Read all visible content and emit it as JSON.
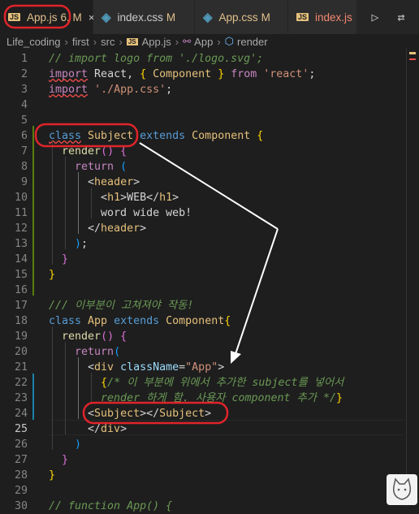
{
  "tabs": [
    {
      "label": "App.js",
      "badge": "6, M",
      "icon": "JS",
      "close": "×",
      "active": true
    },
    {
      "label": "index.css",
      "badge": "M",
      "icon": "css-icon"
    },
    {
      "label": "App.css",
      "badge": "M",
      "icon": "css-icon"
    },
    {
      "label": "index.js",
      "icon": "JS"
    }
  ],
  "tab_actions": {
    "run": "▷",
    "compare": "⇄"
  },
  "breadcrumb": {
    "items": [
      "Life_coding",
      "first",
      "src",
      "App.js",
      "App",
      "render"
    ],
    "sep": "›"
  },
  "editor": {
    "current_line": 25,
    "lines": [
      {
        "n": "1",
        "t": [
          [
            "c-cm",
            "// import logo from './logo.svg';"
          ]
        ]
      },
      {
        "n": "2",
        "t": [
          [
            "c-kw wavy",
            "import"
          ],
          [
            "c-txt",
            " React, "
          ],
          [
            "c-p1",
            "{"
          ],
          [
            "c-txt",
            " "
          ],
          [
            "c-cls",
            "Component"
          ],
          [
            "c-txt",
            " "
          ],
          [
            "c-p1",
            "}"
          ],
          [
            "c-txt",
            " "
          ],
          [
            "c-kw",
            "from"
          ],
          [
            "c-txt",
            " "
          ],
          [
            "c-str",
            "'react'"
          ],
          [
            "c-txt",
            ";"
          ]
        ]
      },
      {
        "n": "3",
        "t": [
          [
            "c-kw wavy",
            "import"
          ],
          [
            "c-txt",
            " "
          ],
          [
            "c-str",
            "'./App.css'"
          ],
          [
            "c-txt",
            ";"
          ]
        ]
      },
      {
        "n": "4",
        "t": []
      },
      {
        "n": "5",
        "t": []
      },
      {
        "n": "6",
        "t": [
          [
            "c-kb wavy",
            "class"
          ],
          [
            "c-txt",
            " "
          ],
          [
            "c-cls",
            "Subject"
          ],
          [
            "c-txt",
            " "
          ],
          [
            "c-kb",
            "extends"
          ],
          [
            "c-txt",
            " "
          ],
          [
            "c-cls",
            "Component"
          ],
          [
            "c-txt",
            " "
          ],
          [
            "c-p1",
            "{"
          ]
        ]
      },
      {
        "n": "7",
        "t": [
          [
            "c-txt",
            "  "
          ],
          [
            "c-fn",
            "render"
          ],
          [
            "c-p2",
            "()"
          ],
          [
            "c-txt",
            " "
          ],
          [
            "c-p2",
            "{"
          ]
        ]
      },
      {
        "n": "8",
        "t": [
          [
            "c-txt",
            "    "
          ],
          [
            "c-kw",
            "return"
          ],
          [
            "c-txt",
            " "
          ],
          [
            "c-p3",
            "("
          ]
        ]
      },
      {
        "n": "9",
        "t": [
          [
            "c-txt",
            "      <"
          ],
          [
            "c-tag",
            "header"
          ],
          [
            "c-txt",
            ">"
          ]
        ]
      },
      {
        "n": "10",
        "t": [
          [
            "c-txt",
            "        <"
          ],
          [
            "c-tag",
            "h1"
          ],
          [
            "c-txt",
            ">WEB</"
          ],
          [
            "c-tag",
            "h1"
          ],
          [
            "c-txt",
            ">"
          ]
        ]
      },
      {
        "n": "11",
        "t": [
          [
            "c-txt",
            "        word wide web!"
          ]
        ]
      },
      {
        "n": "12",
        "t": [
          [
            "c-txt",
            "      </"
          ],
          [
            "c-tag",
            "header"
          ],
          [
            "c-txt",
            ">"
          ]
        ]
      },
      {
        "n": "13",
        "t": [
          [
            "c-txt",
            "    "
          ],
          [
            "c-p3",
            ")"
          ],
          [
            "c-txt",
            ";"
          ]
        ]
      },
      {
        "n": "14",
        "t": [
          [
            "c-txt",
            "  "
          ],
          [
            "c-p2",
            "}"
          ]
        ]
      },
      {
        "n": "15",
        "t": [
          [
            "c-p1",
            "}"
          ]
        ]
      },
      {
        "n": "16",
        "t": []
      },
      {
        "n": "17",
        "t": [
          [
            "c-cm",
            "/// 이부분이 고쳐져야 작동!"
          ]
        ]
      },
      {
        "n": "18",
        "t": [
          [
            "c-kb",
            "class"
          ],
          [
            "c-txt",
            " "
          ],
          [
            "c-cls",
            "App"
          ],
          [
            "c-txt",
            " "
          ],
          [
            "c-kb",
            "extends"
          ],
          [
            "c-txt",
            " "
          ],
          [
            "c-cls",
            "Component"
          ],
          [
            "c-p1",
            "{"
          ]
        ]
      },
      {
        "n": "19",
        "t": [
          [
            "c-txt",
            "  "
          ],
          [
            "c-fn",
            "render"
          ],
          [
            "c-p2",
            "()"
          ],
          [
            "c-txt",
            " "
          ],
          [
            "c-p2",
            "{"
          ]
        ]
      },
      {
        "n": "20",
        "t": [
          [
            "c-txt",
            "    "
          ],
          [
            "c-kw",
            "return"
          ],
          [
            "c-p3",
            "("
          ]
        ]
      },
      {
        "n": "21",
        "t": [
          [
            "c-txt",
            "      <"
          ],
          [
            "c-tag",
            "div"
          ],
          [
            "c-txt",
            " "
          ],
          [
            "c-attr",
            "className"
          ],
          [
            "c-txt",
            "="
          ],
          [
            "c-str",
            "\"App\""
          ],
          [
            "c-txt",
            ">"
          ]
        ]
      },
      {
        "n": "22",
        "t": [
          [
            "c-txt",
            "        "
          ],
          [
            "c-p1",
            "{"
          ],
          [
            "c-cm",
            "/* 이 부분에 위에서 추가한 subject를 넣어서"
          ]
        ]
      },
      {
        "n": "23",
        "t": [
          [
            "c-cm",
            "        render 하게 함. 사용자 component 추가 */"
          ],
          [
            "c-p1",
            "}"
          ]
        ]
      },
      {
        "n": "24",
        "t": [
          [
            "c-txt",
            "      <"
          ],
          [
            "c-tag",
            "Subject"
          ],
          [
            "c-txt",
            "></"
          ],
          [
            "c-tag",
            "Subject"
          ],
          [
            "c-txt",
            ">"
          ]
        ]
      },
      {
        "n": "25",
        "t": [
          [
            "c-txt",
            "      </"
          ],
          [
            "c-tag",
            "div"
          ],
          [
            "c-txt",
            ">"
          ]
        ]
      },
      {
        "n": "26",
        "t": [
          [
            "c-txt",
            "    "
          ],
          [
            "c-p3",
            ")"
          ]
        ]
      },
      {
        "n": "27",
        "t": [
          [
            "c-txt",
            "  "
          ],
          [
            "c-p2",
            "}"
          ]
        ]
      },
      {
        "n": "28",
        "t": [
          [
            "c-p1",
            "}"
          ]
        ]
      },
      {
        "n": "29",
        "t": []
      },
      {
        "n": "30",
        "t": [
          [
            "c-cm",
            "// function App() {"
          ]
        ]
      }
    ]
  },
  "colors": {
    "annotation": "#e0242a",
    "arrow": "#ffffff",
    "modified_gutter": "#1b81a8",
    "added_gutter": "#587c0c"
  }
}
